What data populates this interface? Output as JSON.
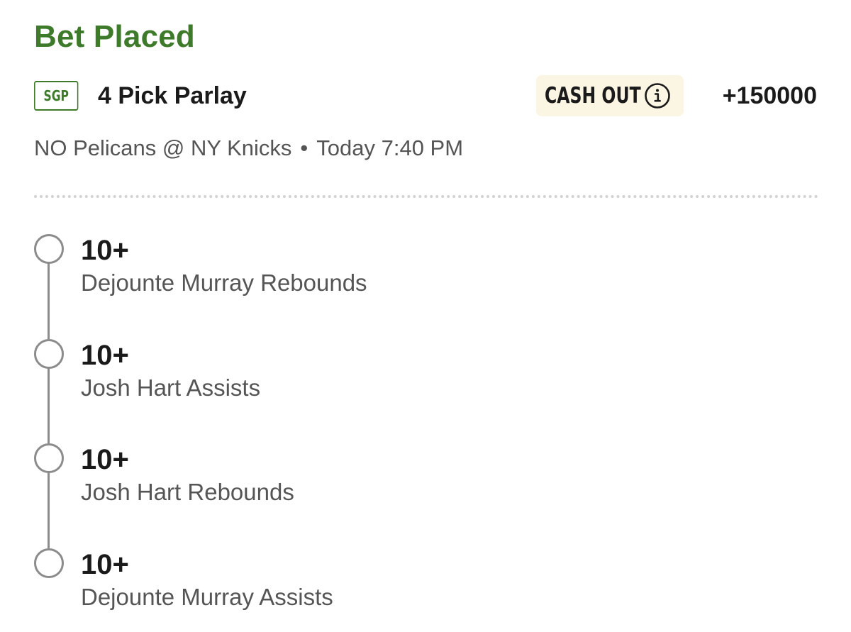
{
  "title": "Bet Placed",
  "bet": {
    "badge": "SGP",
    "type": "4 Pick Parlay",
    "cash_out_label": "CASH OUT",
    "odds": "+150000"
  },
  "game": {
    "matchup": "NO Pelicans @ NY Knicks",
    "separator": "•",
    "time": "Today 7:40 PM"
  },
  "legs": [
    {
      "line": "10+",
      "market": "Dejounte Murray Rebounds"
    },
    {
      "line": "10+",
      "market": "Josh Hart Assists"
    },
    {
      "line": "10+",
      "market": "Josh Hart Rebounds"
    },
    {
      "line": "10+",
      "market": "Dejounte Murray Assists"
    }
  ],
  "colors": {
    "accent_green": "#3d7a2a",
    "cash_out_bg": "#fbf5e3",
    "muted_text": "#555555"
  },
  "icons": {
    "cash_out_info": "info-icon",
    "leg_status": "empty-circle-icon"
  }
}
